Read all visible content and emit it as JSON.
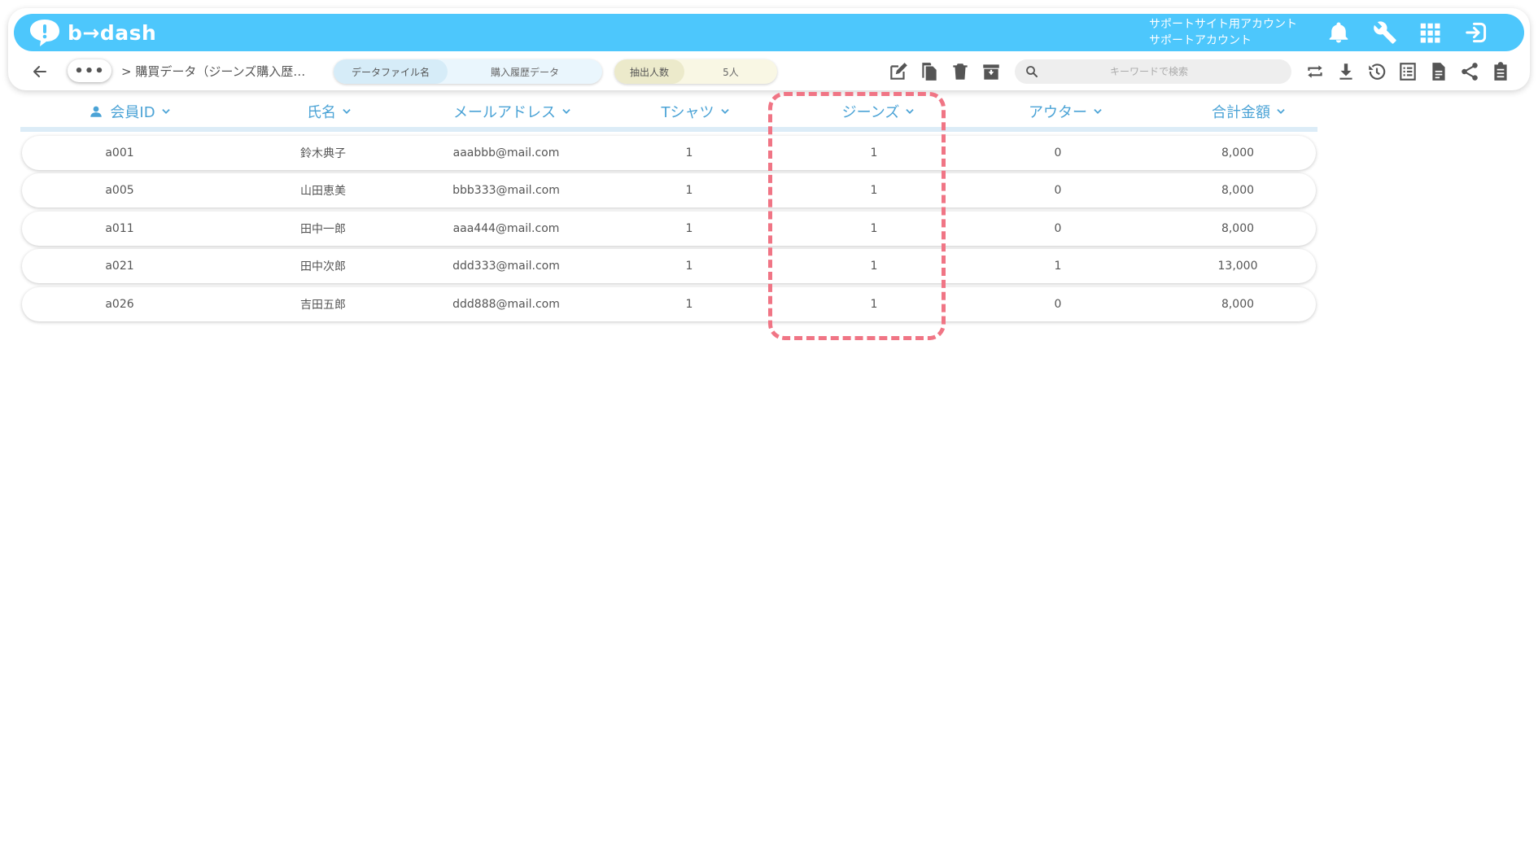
{
  "app": {
    "logo_text": "b→dash",
    "account_line1": "サポートサイト用アカウント",
    "account_line2": "サポートアカウント",
    "accent_color": "#4dc7fc"
  },
  "toolbar": {
    "more_label": "•••",
    "breadcrumb": "> 購買データ（ジーンズ購入歴…",
    "file_label": "データファイル名",
    "file_value": "購入履歴データ",
    "count_label": "抽出人数",
    "count_value": "5人",
    "search_placeholder": "キーワードで検索"
  },
  "table": {
    "headers": [
      "会員ID",
      "氏名",
      "メールアドレス",
      "Tシャツ",
      "ジーンズ",
      "アウター",
      "合計金額"
    ],
    "rows": [
      [
        "a001",
        "鈴木典子",
        "aaabbb@mail.com",
        "1",
        "1",
        "0",
        "8,000"
      ],
      [
        "a005",
        "山田恵美",
        "bbb333@mail.com",
        "1",
        "1",
        "0",
        "8,000"
      ],
      [
        "a011",
        "田中一郎",
        "aaa444@mail.com",
        "1",
        "1",
        "0",
        "8,000"
      ],
      [
        "a021",
        "田中次郎",
        "ddd333@mail.com",
        "1",
        "1",
        "1",
        "13,000"
      ],
      [
        "a026",
        "吉田五郎",
        "ddd888@mail.com",
        "1",
        "1",
        "0",
        "8,000"
      ]
    ],
    "highlight_color": "#f07585",
    "header_color": "#4ba3d6"
  }
}
